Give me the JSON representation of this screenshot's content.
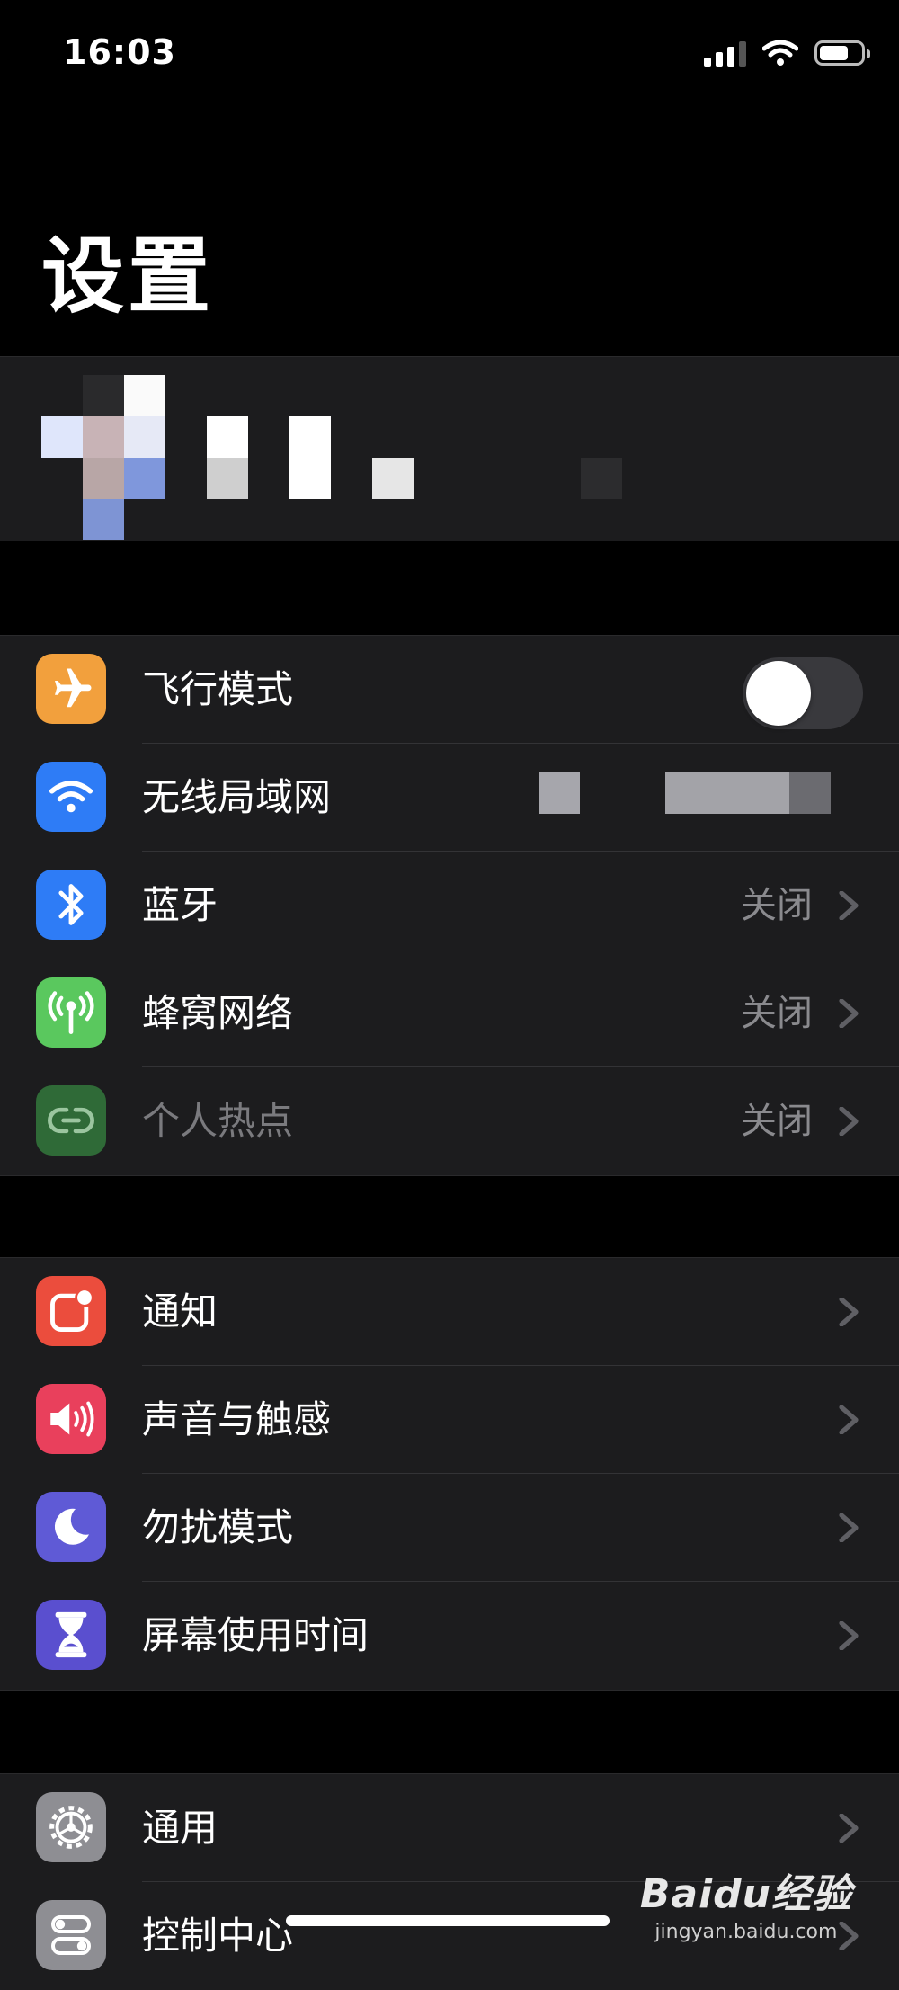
{
  "status": {
    "time": "16:03"
  },
  "title": "设置",
  "groups": [
    [
      {
        "label": "飞行模式",
        "icon": "airplane-icon",
        "color": "#f2a03d",
        "toggle": false
      },
      {
        "label": "无线局域网",
        "icon": "wifi-icon",
        "color": "#2e7cf6"
      },
      {
        "label": "蓝牙",
        "icon": "bluetooth-icon",
        "color": "#2e7cf6",
        "value": "关闭"
      },
      {
        "label": "蜂窝网络",
        "icon": "cellular-icon",
        "color": "#5ac85e",
        "value": "关闭"
      },
      {
        "label": "个人热点",
        "icon": "hotspot-icon",
        "color": "#2f6a37",
        "value": "关闭",
        "disabled": true
      }
    ],
    [
      {
        "label": "通知",
        "icon": "notifications-icon",
        "color": "#eb4d3d"
      },
      {
        "label": "声音与触感",
        "icon": "sound-icon",
        "color": "#e9405c"
      },
      {
        "label": "勿扰模式",
        "icon": "moon-icon",
        "color": "#5f5ad6"
      },
      {
        "label": "屏幕使用时间",
        "icon": "hourglass-icon",
        "color": "#5a4fcf"
      }
    ],
    [
      {
        "label": "通用",
        "icon": "gear-icon",
        "color": "#8e8e93"
      },
      {
        "label": "控制中心",
        "icon": "switches-icon",
        "color": "#8e8e93"
      }
    ]
  ],
  "watermark": {
    "logo": "Baidu经验",
    "url": "jingyan.baidu.com"
  }
}
